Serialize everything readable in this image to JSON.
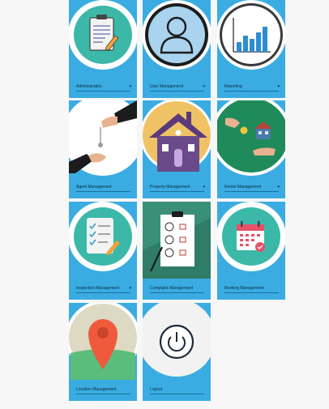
{
  "tiles": [
    {
      "label": "Administration",
      "icon": "clipboard-icon",
      "dropdown": true
    },
    {
      "label": "User Management",
      "icon": "user-icon",
      "dropdown": true
    },
    {
      "label": "Reporting",
      "icon": "bar-chart-icon",
      "dropdown": true
    },
    {
      "label": "Agent Management",
      "icon": "handing-key-icon",
      "dropdown": false
    },
    {
      "label": "Property Management",
      "icon": "house-icon",
      "dropdown": true
    },
    {
      "label": "Rental Management",
      "icon": "rental-hands-icon",
      "dropdown": true
    },
    {
      "label": "Inspection Management",
      "icon": "checklist-icon",
      "dropdown": true
    },
    {
      "label": "Complaint Management",
      "icon": "feedback-form-icon",
      "dropdown": false
    },
    {
      "label": "Booking Management",
      "icon": "calendar-icon",
      "dropdown": false
    },
    {
      "label": "Location Management",
      "icon": "map-pin-icon",
      "dropdown": false
    },
    {
      "label": "Logout",
      "icon": "power-icon",
      "dropdown": false
    }
  ],
  "chevron_glyph": "▾",
  "colors": {
    "tile": "#3aace2",
    "background": "#f7f7f7",
    "circle_teal": "#3bb8a8",
    "label_text": "#0d2a3c"
  }
}
